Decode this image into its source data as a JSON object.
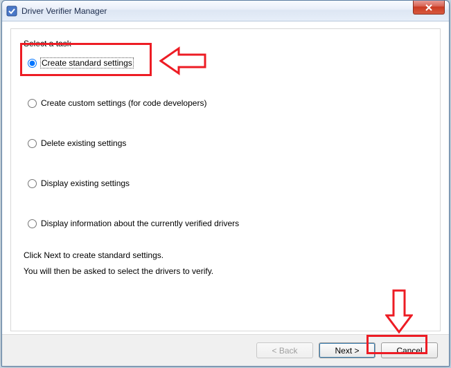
{
  "window": {
    "title": "Driver Verifier Manager"
  },
  "section": {
    "label": "Select a task"
  },
  "options": {
    "o1": "Create standard settings",
    "o2": "Create custom settings (for code developers)",
    "o3": "Delete existing settings",
    "o4": "Display existing settings",
    "o5": "Display information about the currently verified drivers"
  },
  "hint": {
    "line1": "Click Next to create standard settings.",
    "line2": "You will then be asked to select the drivers to verify."
  },
  "buttons": {
    "back": "< Back",
    "next": "Next >",
    "cancel": "Cancel"
  },
  "icons": {
    "close": "close-icon",
    "app": "verifier-app-icon"
  },
  "annotation_color": "#ed1c24"
}
